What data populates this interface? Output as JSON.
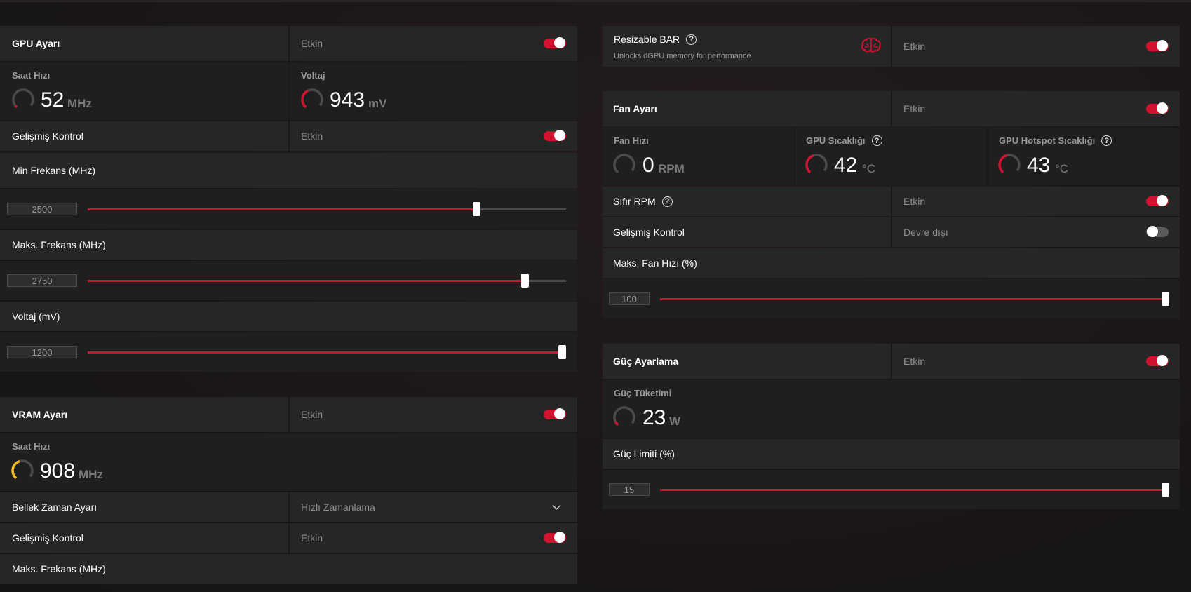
{
  "colors": {
    "accent": "#d2122e",
    "vram_gauge": "#f2b81e",
    "panel": "#262626",
    "panel_dark": "#1f1f1f"
  },
  "gpu": {
    "title": "GPU Ayarı",
    "state": "Etkin",
    "clock": {
      "label": "Saat Hızı",
      "value": "52",
      "unit": "MHz"
    },
    "voltage": {
      "label": "Voltaj",
      "value": "943",
      "unit": "mV"
    },
    "advanced": {
      "label": "Gelişmiş Kontrol",
      "state": "Etkin"
    },
    "min_freq": {
      "label": "Min Frekans (MHz)",
      "value": "2500",
      "fraction": 0.812
    },
    "max_freq": {
      "label": "Maks. Frekans (MHz)",
      "value": "2750",
      "fraction": 0.913
    },
    "volt_mv": {
      "label": "Voltaj (mV)",
      "value": "1200",
      "fraction": 1.0
    }
  },
  "vram": {
    "title": "VRAM Ayarı",
    "state": "Etkin",
    "clock": {
      "label": "Saat Hızı",
      "value": "908",
      "unit": "MHz"
    },
    "timing": {
      "label": "Bellek Zaman Ayarı",
      "value": "Hızlı Zamanlama"
    },
    "advanced": {
      "label": "Gelişmiş Kontrol",
      "state": "Etkin"
    },
    "max_freq": {
      "label": "Maks. Frekans (MHz)"
    }
  },
  "rebar": {
    "title": "Resizable BAR",
    "subtitle": "Unlocks dGPU memory for performance",
    "state": "Etkin",
    "icon": "brain-icon"
  },
  "fan": {
    "title": "Fan Ayarı",
    "state": "Etkin",
    "speed": {
      "label": "Fan Hızı",
      "value": "0",
      "unit": "RPM"
    },
    "temp": {
      "label": "GPU Sıcaklığı",
      "value": "42",
      "unit": "°C"
    },
    "hotspot": {
      "label": "GPU Hotspot Sıcaklığı",
      "value": "43",
      "unit": "°C"
    },
    "zero_rpm": {
      "label": "Sıfır RPM",
      "state": "Etkin"
    },
    "advanced": {
      "label": "Gelişmiş Kontrol",
      "state": "Devre dışı"
    },
    "max_speed": {
      "label": "Maks. Fan Hızı (%)",
      "value": "100",
      "fraction": 1.0
    }
  },
  "power": {
    "title": "Güç Ayarlama",
    "state": "Etkin",
    "consumption": {
      "label": "Güç Tüketimi",
      "value": "23",
      "unit": "W"
    },
    "limit": {
      "label": "Güç Limiti (%)",
      "value": "15",
      "fraction": 1.0
    }
  }
}
